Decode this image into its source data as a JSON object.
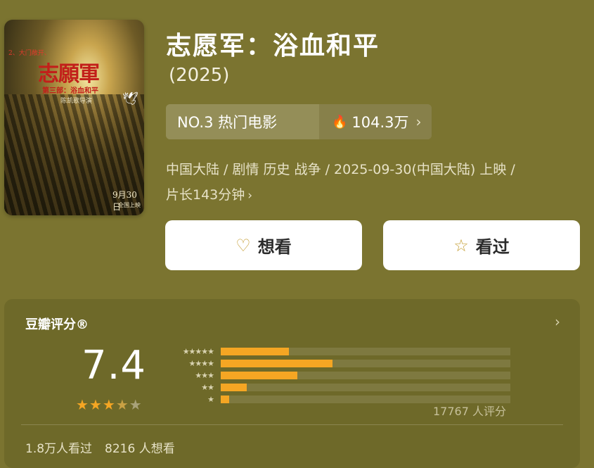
{
  "poster": {
    "tag": "2、大门敞开、",
    "title": "志願軍",
    "subtitle": "第三部：浴血和平",
    "director": "陈凯歌导演",
    "date": "9月30日",
    "release": "全国上映"
  },
  "movie": {
    "title": "志愿军：浴血和平",
    "year": "(2025)"
  },
  "rank": {
    "label": "NO.3 热门电影",
    "heat_icon": "flame-icon",
    "heat": "104.3万"
  },
  "meta": {
    "line1": "中国大陆 / 剧情 历史 战争 / 2025-09-30(中国大陆) 上映 /",
    "line2": "片长143分钟"
  },
  "actions": {
    "want_icon": "heart-plus-icon",
    "want_label": "想看",
    "seen_icon": "star-outline-icon",
    "seen_label": "看过"
  },
  "rating": {
    "label": "豆瓣评分®",
    "score": "7.4",
    "stars": 3.5,
    "distribution": [
      {
        "stars": "★★★★★",
        "fraction": 0.235
      },
      {
        "stars": "★★★★",
        "fraction": 0.385
      },
      {
        "stars": "★★★",
        "fraction": 0.265
      },
      {
        "stars": "★★",
        "fraction": 0.09
      },
      {
        "stars": "★",
        "fraction": 0.03
      }
    ],
    "count": "17767 人评分",
    "watched": "1.8万人看过",
    "wish": "8216 人想看"
  },
  "colors": {
    "background": "#7b7430",
    "accent": "#f5a623"
  }
}
